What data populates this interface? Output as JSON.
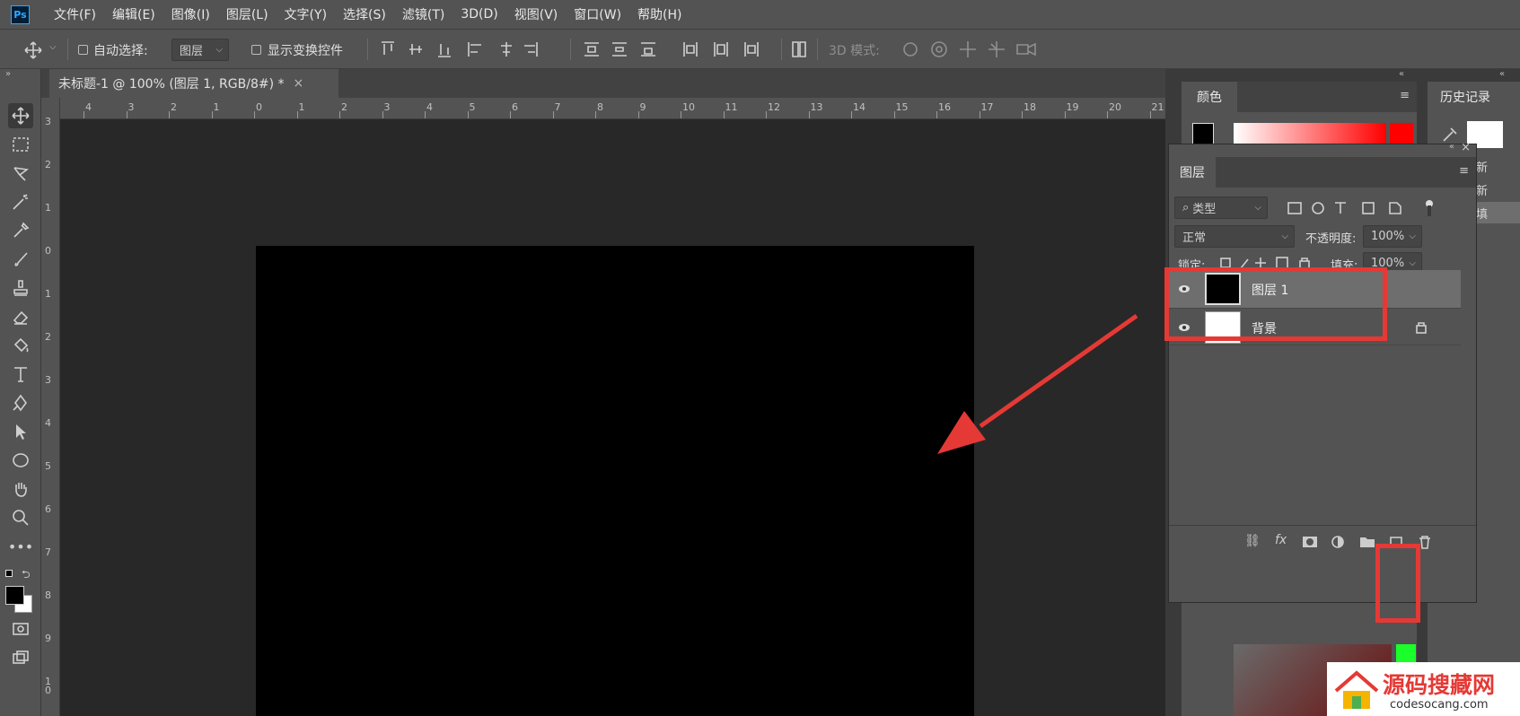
{
  "app": {
    "logo": "Ps"
  },
  "menu": [
    "文件(F)",
    "编辑(E)",
    "图像(I)",
    "图层(L)",
    "文字(Y)",
    "选择(S)",
    "滤镜(T)",
    "3D(D)",
    "视图(V)",
    "窗口(W)",
    "帮助(H)"
  ],
  "options": {
    "auto_select_label": "自动选择:",
    "auto_select_value": "图层",
    "show_transform_label": "显示变换控件",
    "mode3d_label": "3D 模式:"
  },
  "document": {
    "tab_title": "未标题-1 @ 100% (图层 1, RGB/8#) *",
    "close_glyph": "×"
  },
  "ruler": {
    "top": [
      "4",
      "3",
      "2",
      "1",
      "0",
      "1",
      "2",
      "3",
      "4",
      "5",
      "6",
      "7",
      "8",
      "9",
      "10",
      "11",
      "12",
      "13",
      "14",
      "15",
      "16",
      "17",
      "18",
      "19",
      "20",
      "21"
    ],
    "left": [
      "3",
      "2",
      "1",
      "0",
      "1",
      "2",
      "3",
      "4",
      "5",
      "6",
      "7",
      "8",
      "9",
      "1 0"
    ]
  },
  "panels": {
    "color_tab": "颜色",
    "history_tab": "历史记录",
    "history_items": [
      "新",
      "新",
      "填"
    ]
  },
  "layers_panel": {
    "tab": "图层",
    "filter_label": "类型",
    "blend_mode": "正常",
    "opacity_label": "不透明度:",
    "opacity_value": "100%",
    "lock_label": "锁定:",
    "fill_label": "填充:",
    "fill_value": "100%",
    "layers": [
      {
        "name": "图层 1",
        "selected": true,
        "thumb_color": "#000000"
      },
      {
        "name": "背景",
        "selected": false,
        "thumb_color": "#ffffff",
        "locked": true
      }
    ]
  },
  "watermark": {
    "text": "源码搜藏网",
    "url": "codesocang.com"
  },
  "colors": {
    "accent_red": "#e53935",
    "ui_bg": "#535353",
    "canvas_bg": "#282828",
    "green_bar": "#1aff2a"
  }
}
